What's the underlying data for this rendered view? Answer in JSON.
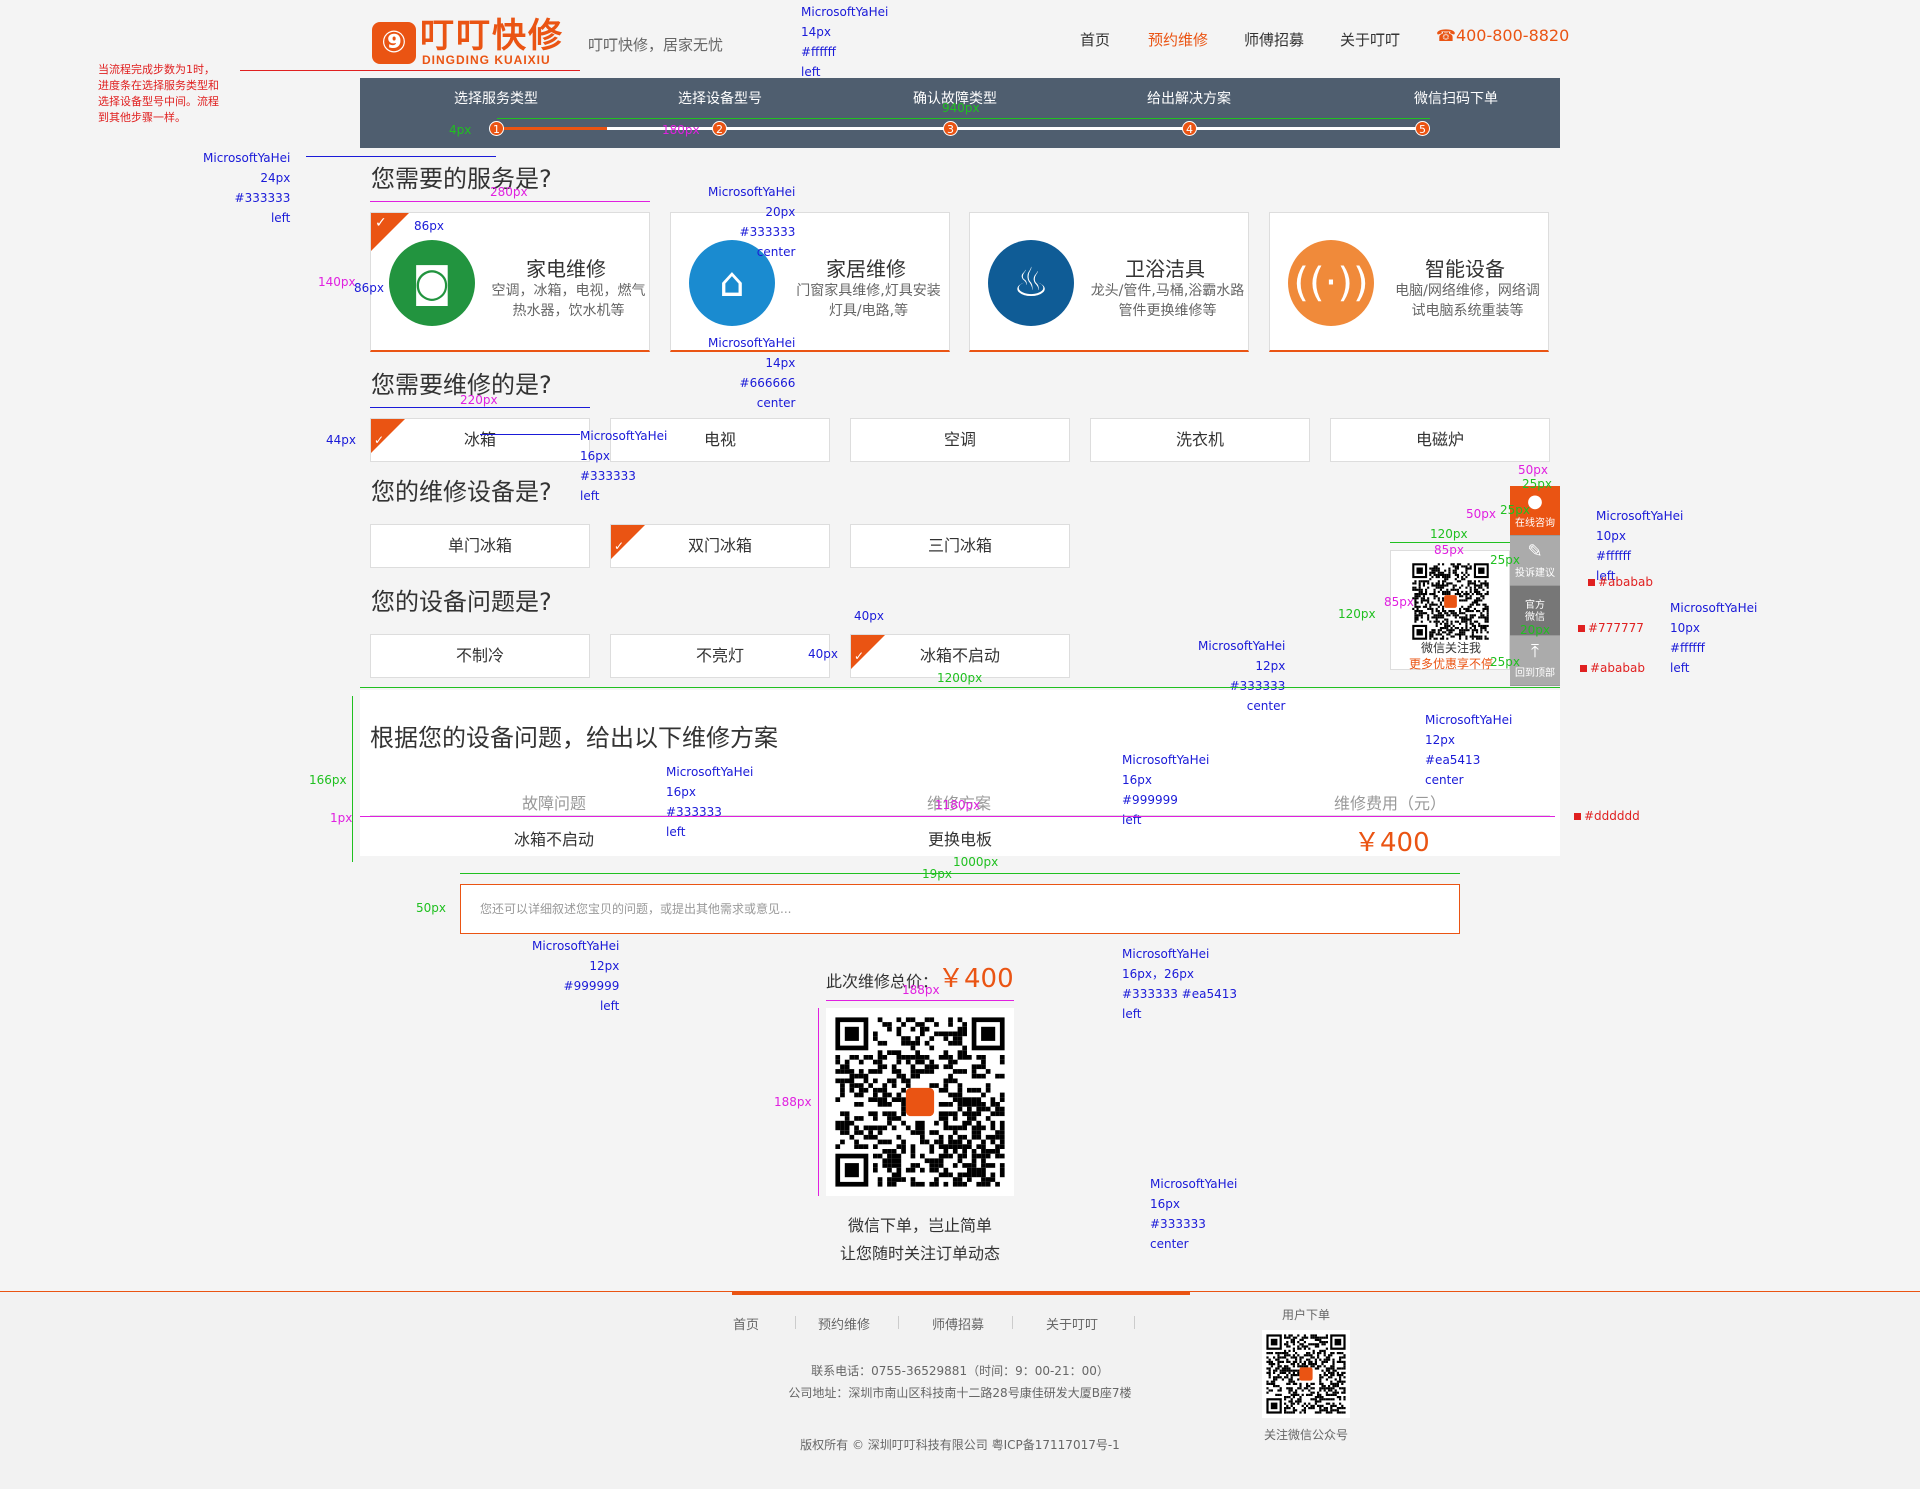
{
  "header": {
    "logo_cn": "叮叮快修",
    "logo_en": "DINGDING KUAIXIU",
    "slogan": "叮叮快修，居家无忧",
    "nav": [
      "首页",
      "预约维修",
      "师傅招募",
      "关于叮叮"
    ],
    "phone": "400-800-8820"
  },
  "steps": {
    "labels": [
      "选择服务类型",
      "选择设备型号",
      "确认故障类型",
      "给出解决方案",
      "微信扫码下单"
    ],
    "numbers": [
      "1",
      "2",
      "3",
      "4",
      "5"
    ]
  },
  "service": {
    "title": "您需要的服务是?",
    "cards": [
      {
        "title": "家电维修",
        "desc": "空调，冰箱，电视，燃气热水器，饮水机等",
        "color": "#22943f",
        "icon": "camera-appliance-icon"
      },
      {
        "title": "家居维修",
        "desc": "门窗家具维修,灯具安装灯具/电路,等",
        "color": "#1a8bd0",
        "icon": "house-wrench-icon"
      },
      {
        "title": "卫浴洁具",
        "desc": "龙头/管件,马桶,浴霸水路管件更换维修等",
        "color": "#0f5c96",
        "icon": "toilet-icon"
      },
      {
        "title": "智能设备",
        "desc": "电脑/网络维修，网络调试电脑系统重装等",
        "color": "#f08a3a",
        "icon": "wifi-signal-icon"
      }
    ]
  },
  "repair": {
    "title": "您需要维修的是?",
    "options": [
      "冰箱",
      "电视",
      "空调",
      "洗衣机",
      "电磁炉"
    ]
  },
  "device": {
    "title": "您的维修设备是?",
    "options": [
      "单门冰箱",
      "双门冰箱",
      "三门冰箱"
    ]
  },
  "problem": {
    "title": "您的设备问题是?",
    "options": [
      "不制冷",
      "不亮灯",
      "冰箱不启动"
    ]
  },
  "solution": {
    "title": "根据您的设备问题，给出以下维修方案",
    "headers": [
      "故障问题",
      "维修方案",
      "维修费用（元）"
    ],
    "fault": "冰箱不启动",
    "plan": "更换电板",
    "price": "￥400"
  },
  "textarea": {
    "placeholder": "您还可以详细叙述您宝贝的问题，或提出其他需求或意见..."
  },
  "total": {
    "label": "此次维修总价：",
    "price": "￥400"
  },
  "qr_caption": [
    "微信下单，岂止简单",
    "让您随时关注订单动态"
  ],
  "side": {
    "items": [
      "在线咨询",
      "投诉建议",
      "微信",
      "回到顶部"
    ],
    "wx_top": "官方",
    "pop_line1": "微信关注我",
    "pop_line2": "更多优惠享不停"
  },
  "footer": {
    "nav": [
      "首页",
      "预约维修",
      "师傅招募",
      "关于叮叮"
    ],
    "contact": "联系电话：0755-36529881（时间：9：00-21：00）",
    "address": "公司地址：深圳市南山区科技南十二路28号康佳研发大厦B座7楼",
    "copyright": "版权所有 ©    深圳叮叮科技有限公司  粤ICP备17117017号-1",
    "qr_top": "用户下单",
    "qr_bottom": "关注微信公众号"
  },
  "annotations": {
    "progress_note": "当流程完成步数为1时，\n进度条在选择服务类型和\n选择设备型号中间。流程\n到其他步骤一样。",
    "steps_font": "MicrosoftYaHei\n14px\n#ffffff\nleft",
    "title_font": "MicrosoftYaHei\n24px\n#333333\nleft",
    "card_title_font": "MicrosoftYaHei\n20px\n#333333\ncenter",
    "card_desc_font": "MicrosoftYaHei\n14px\n#666666\ncenter",
    "option_font": "MicrosoftYaHei\n16px\n#333333\nleft",
    "side_font_1": "MicrosoftYaHei\n10px\n#ffffff\nleft",
    "side_font_2": "MicrosoftYaHei\n10px\n#ffffff\nleft",
    "pop_font_1": "MicrosoftYaHei\n12px\n#333333\ncenter",
    "pop_font_2": "MicrosoftYaHei\n12px\n#ea5413\ncenter",
    "fault_font": "MicrosoftYaHei\n16px\n#333333\nleft",
    "header_font": "MicrosoftYaHei\n16px\n#999999\nleft",
    "textarea_font": "MicrosoftYaHei\n12px\n#999999\nleft",
    "total_font": "MicrosoftYaHei\n16px，26px\n#333333 #ea5413\nleft",
    "qr_font": "MicrosoftYaHei\n16px\n#333333\ncenter",
    "color_ababab": "#ababab",
    "color_777777": "#777777",
    "color_dddddd": "#dddddd",
    "dims": {
      "d940": "940px",
      "d4": "4px",
      "d180": "180px",
      "d280": "280px",
      "d86": "86px",
      "d140": "140px",
      "d86v": "86px",
      "d220": "220px",
      "d44": "44px",
      "d40": "40px",
      "d40v": "40px",
      "d1200": "1200px",
      "d166": "166px",
      "d1": "1px",
      "d1180": "1180px",
      "d1000": "1000px",
      "d19": "19px",
      "d50": "50px",
      "d188": "188px",
      "d188v": "188px",
      "d50a": "50px",
      "d25a": "25px",
      "d50b": "50px",
      "d25b": "25px",
      "d120": "120px",
      "d85": "85px",
      "d120v": "120px",
      "d85v": "85px",
      "d25c": "25px",
      "d25d": "25px",
      "d20": "20px"
    }
  }
}
